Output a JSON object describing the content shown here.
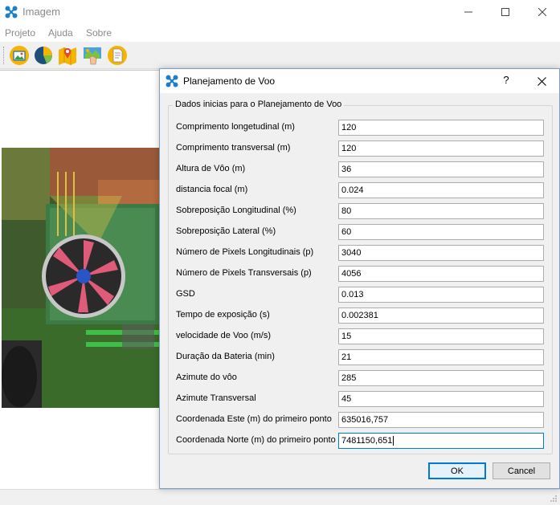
{
  "window": {
    "title": "Imagem"
  },
  "menu": [
    "Projeto",
    "Ajuda",
    "Sobre"
  ],
  "toolbar": {
    "icons": [
      "image-icon",
      "pie-chart-icon",
      "map-pin-icon",
      "map-hand-icon",
      "document-icon"
    ]
  },
  "dialog": {
    "title": "Planejamento de Voo",
    "help": "?",
    "group_title": "Dados inicias para o Planejamento de Voo",
    "fields": [
      {
        "label": "Comprimento longetudinal (m)",
        "value": "120"
      },
      {
        "label": "Comprimento transversal (m)",
        "value": "120"
      },
      {
        "label": "Altura de Vôo (m)",
        "value": "36"
      },
      {
        "label": "distancia focal (m)",
        "value": "0.024"
      },
      {
        "label": "Sobreposição Longitudinal (%)",
        "value": "80"
      },
      {
        "label": "Sobreposição Lateral (%)",
        "value": "60"
      },
      {
        "label": "Número de Pixels Longitudinais (p)",
        "value": "3040"
      },
      {
        "label": "Número de Pixels Transversais (p)",
        "value": "4056"
      },
      {
        "label": "GSD",
        "value": "0.013"
      },
      {
        "label": "Tempo de exposição (s)",
        "value": "0.002381"
      },
      {
        "label": "velocidade de Voo (m/s)",
        "value": "15"
      },
      {
        "label": "Duração da Bateria (min)",
        "value": "21"
      },
      {
        "label": "Azimute do vôo",
        "value": "285"
      },
      {
        "label": "Azimute Transversal",
        "value": "45"
      },
      {
        "label": "Coordenada Este (m) do primeiro ponto",
        "value": "635016,757"
      },
      {
        "label": "Coordenada Norte (m) do primeiro ponto",
        "value": "7481150,651"
      }
    ],
    "ok_label": "OK",
    "cancel_label": "Cancel"
  },
  "colors": {
    "accent": "#0078d7",
    "app_icon": "#1e7fc8"
  }
}
